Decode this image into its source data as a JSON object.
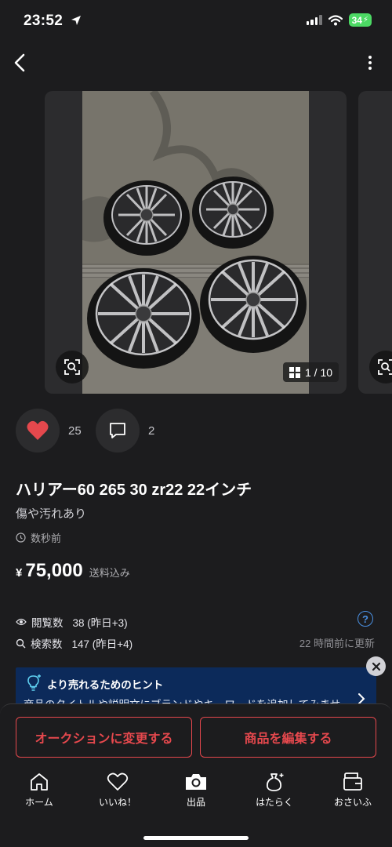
{
  "status_bar": {
    "time": "23:52",
    "battery": "34"
  },
  "gallery": {
    "counter": "1 / 10"
  },
  "engagement": {
    "likes": "25",
    "comments": "2"
  },
  "item": {
    "title": "ハリアー60 265 30 zr22 22インチ",
    "condition": "傷や汚れあり",
    "posted": "数秒前",
    "currency": "¥",
    "price": "75,000",
    "shipping": "送料込み"
  },
  "stats": {
    "views_label": "閲覧数",
    "views_value": "38 (昨日+3)",
    "search_label": "検索数",
    "search_value": "147 (昨日+4)",
    "help": "?",
    "updated": "22 時間前に更新"
  },
  "hint": {
    "title": "より売れるためのヒント",
    "text": "商品のタイトルや説明文にブランドやキーワードを追加してみませ"
  },
  "actions": {
    "auction": "オークションに変更する",
    "edit": "商品を編集する"
  },
  "tabbar": [
    {
      "label": "ホーム",
      "icon": "home-icon"
    },
    {
      "label": "いいね！",
      "icon": "heart-outline-icon"
    },
    {
      "label": "出品",
      "icon": "camera-icon"
    },
    {
      "label": "はたらく",
      "icon": "money-bag-icon"
    },
    {
      "label": "おさいふ",
      "icon": "wallet-icon"
    }
  ],
  "colors": {
    "accent": "#e5484d",
    "hint_bg": "#0c2a5a",
    "link": "#4a90e2"
  }
}
